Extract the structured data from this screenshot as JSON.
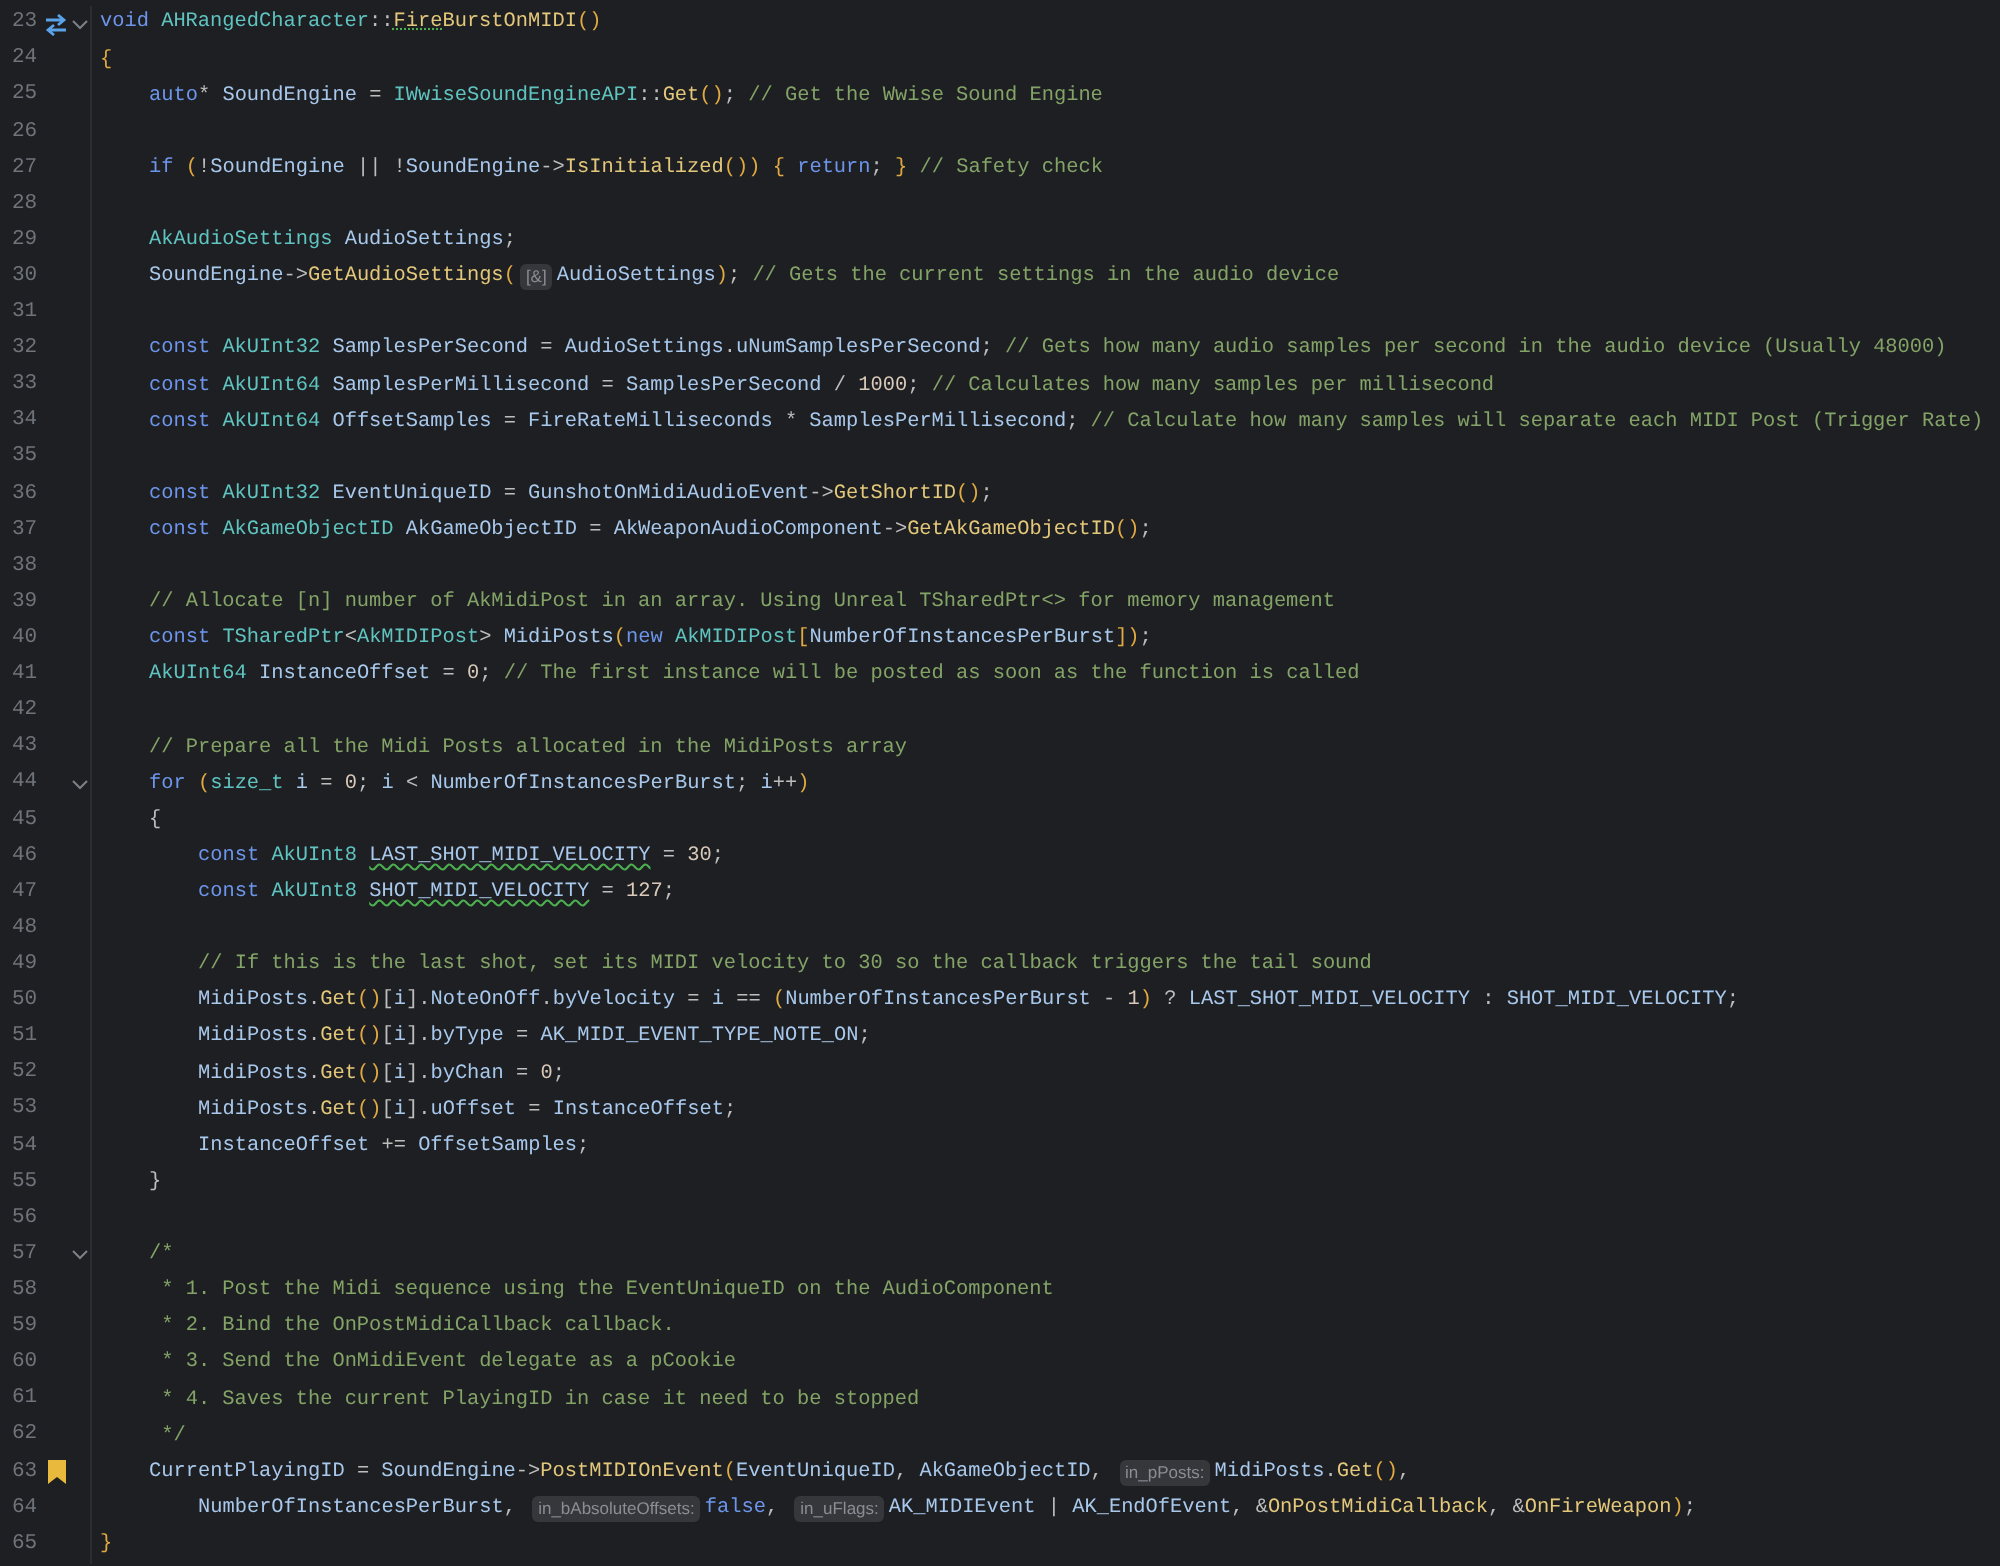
{
  "lines": [
    {
      "number": "23",
      "overrides": true,
      "fold": true,
      "segments": [
        {
          "kind": "kw",
          "text": "void "
        },
        {
          "kind": "type",
          "text": "AHRangedCharacter"
        },
        {
          "kind": "plain",
          "text": "::"
        },
        {
          "kind": "warnfunc",
          "text": "Fire"
        },
        {
          "kind": "func",
          "text": "BurstOnMIDI"
        },
        {
          "kind": "paren",
          "text": "()"
        }
      ]
    },
    {
      "number": "24",
      "fold": false,
      "segments": [
        {
          "kind": "paren",
          "text": "{"
        }
      ],
      "children": [
        {
          "number": "25",
          "fold": false,
          "segments": [
            {
              "kind": "kw",
              "text": "auto"
            },
            {
              "kind": "plain",
              "text": "* "
            },
            {
              "kind": "var",
              "text": "SoundEngine"
            },
            {
              "kind": "plain",
              "text": " = "
            },
            {
              "kind": "type",
              "text": "IWwiseSoundEngineAPI"
            },
            {
              "kind": "plain",
              "text": "::"
            },
            {
              "kind": "func",
              "text": "Get"
            },
            {
              "kind": "paren",
              "text": "()"
            },
            {
              "kind": "plain",
              "text": "; "
            },
            {
              "kind": "comment",
              "text": "// Get the Wwise Sound Engine"
            }
          ]
        },
        {
          "number": "26",
          "fold": false
        },
        {
          "number": "27",
          "fold": false,
          "segments": [
            {
              "kind": "kw",
              "text": "if "
            },
            {
              "kind": "paren",
              "text": "("
            },
            {
              "kind": "plain",
              "text": "!"
            },
            {
              "kind": "var",
              "text": "SoundEngine"
            },
            {
              "kind": "plain",
              "text": " || !"
            },
            {
              "kind": "var",
              "text": "SoundEngine"
            },
            {
              "kind": "plain",
              "text": "->"
            },
            {
              "kind": "func",
              "text": "IsInitialized"
            },
            {
              "kind": "paren",
              "text": "()) "
            },
            {
              "kind": "paren",
              "text": "{ "
            },
            {
              "kind": "kw",
              "text": "return"
            },
            {
              "kind": "plain",
              "text": "; "
            },
            {
              "kind": "paren",
              "text": "} "
            },
            {
              "kind": "comment",
              "text": "// Safety check"
            }
          ]
        },
        {
          "number": "28",
          "fold": false
        },
        {
          "number": "29",
          "fold": false,
          "segments": [
            {
              "kind": "type",
              "text": "AkAudioSettings "
            },
            {
              "kind": "var",
              "text": "AudioSettings"
            },
            {
              "kind": "plain",
              "text": ";"
            }
          ]
        },
        {
          "number": "30",
          "fold": false,
          "segments": [
            {
              "kind": "var",
              "text": "SoundEngine"
            },
            {
              "kind": "plain",
              "text": "->"
            },
            {
              "kind": "func",
              "text": "GetAudioSettings"
            },
            {
              "kind": "paren",
              "text": "("
            },
            {
              "kind": "hint",
              "text": "[&]"
            },
            {
              "kind": "var",
              "text": "AudioSettings"
            },
            {
              "kind": "paren",
              "text": ")"
            },
            {
              "kind": "plain",
              "text": "; "
            },
            {
              "kind": "comment",
              "text": "// Gets the current settings in the audio device"
            }
          ]
        },
        {
          "number": "31",
          "fold": false
        },
        {
          "number": "32",
          "fold": false,
          "segments": [
            {
              "kind": "kw",
              "text": "const "
            },
            {
              "kind": "type",
              "text": "AkUInt32 "
            },
            {
              "kind": "var",
              "text": "SamplesPerSecond"
            },
            {
              "kind": "plain",
              "text": " = "
            },
            {
              "kind": "var",
              "text": "AudioSettings"
            },
            {
              "kind": "plain",
              "text": "."
            },
            {
              "kind": "var",
              "text": "uNumSamplesPerSecond"
            },
            {
              "kind": "plain",
              "text": "; "
            },
            {
              "kind": "comment",
              "text": "// Gets how many audio samples per second in the audio device (Usually 48000)"
            }
          ]
        },
        {
          "number": "33",
          "fold": false,
          "segments": [
            {
              "kind": "kw",
              "text": "const "
            },
            {
              "kind": "type",
              "text": "AkUInt64 "
            },
            {
              "kind": "var",
              "text": "SamplesPerMillisecond"
            },
            {
              "kind": "plain",
              "text": " = "
            },
            {
              "kind": "var",
              "text": "SamplesPerSecond"
            },
            {
              "kind": "plain",
              "text": " / "
            },
            {
              "kind": "num",
              "text": "1000"
            },
            {
              "kind": "plain",
              "text": "; "
            },
            {
              "kind": "comment",
              "text": "// Calculates how many samples per millisecond"
            }
          ]
        },
        {
          "number": "34",
          "fold": false,
          "segments": [
            {
              "kind": "kw",
              "text": "const "
            },
            {
              "kind": "type",
              "text": "AkUInt64 "
            },
            {
              "kind": "var",
              "text": "OffsetSamples"
            },
            {
              "kind": "plain",
              "text": " = "
            },
            {
              "kind": "var",
              "text": "FireRateMilliseconds"
            },
            {
              "kind": "plain",
              "text": " * "
            },
            {
              "kind": "var",
              "text": "SamplesPerMillisecond"
            },
            {
              "kind": "plain",
              "text": "; "
            },
            {
              "kind": "comment",
              "text": "// Calculate how many samples will separate each MIDI Post (Trigger Rate)"
            }
          ]
        },
        {
          "number": "35",
          "fold": false
        },
        {
          "number": "36",
          "fold": false,
          "segments": [
            {
              "kind": "kw",
              "text": "const "
            },
            {
              "kind": "type",
              "text": "AkUInt32 "
            },
            {
              "kind": "var",
              "text": "EventUniqueID"
            },
            {
              "kind": "plain",
              "text": " = "
            },
            {
              "kind": "var",
              "text": "GunshotOnMidiAudioEvent"
            },
            {
              "kind": "plain",
              "text": "->"
            },
            {
              "kind": "func",
              "text": "GetShortID"
            },
            {
              "kind": "paren",
              "text": "()"
            },
            {
              "kind": "plain",
              "text": ";"
            }
          ]
        },
        {
          "number": "37",
          "fold": false,
          "segments": [
            {
              "kind": "kw",
              "text": "const "
            },
            {
              "kind": "type",
              "text": "AkGameObjectID "
            },
            {
              "kind": "var",
              "text": "AkGameObjectID"
            },
            {
              "kind": "plain",
              "text": " = "
            },
            {
              "kind": "var",
              "text": "AkWeaponAudioComponent"
            },
            {
              "kind": "plain",
              "text": "->"
            },
            {
              "kind": "func",
              "text": "GetAkGameObjectID"
            },
            {
              "kind": "paren",
              "text": "()"
            },
            {
              "kind": "plain",
              "text": ";"
            }
          ]
        },
        {
          "number": "38",
          "fold": false
        },
        {
          "number": "39",
          "fold": false,
          "segments": [
            {
              "kind": "comment",
              "text": "// Allocate [n] number of AkMidiPost in an array. Using Unreal TSharedPtr<> for memory management"
            }
          ]
        },
        {
          "number": "40",
          "fold": false,
          "segments": [
            {
              "kind": "kw",
              "text": "const "
            },
            {
              "kind": "type",
              "text": "TSharedPtr"
            },
            {
              "kind": "plain",
              "text": "<"
            },
            {
              "kind": "type",
              "text": "AkMIDIPost"
            },
            {
              "kind": "plain",
              "text": "> "
            },
            {
              "kind": "var",
              "text": "MidiPosts"
            },
            {
              "kind": "paren",
              "text": "("
            },
            {
              "kind": "kw",
              "text": "new "
            },
            {
              "kind": "type",
              "text": "AkMIDIPost"
            },
            {
              "kind": "paren",
              "text": "["
            },
            {
              "kind": "var",
              "text": "NumberOfInstancesPerBurst"
            },
            {
              "kind": "paren",
              "text": "])"
            },
            {
              "kind": "plain",
              "text": ";"
            }
          ]
        },
        {
          "number": "41",
          "fold": false,
          "segments": [
            {
              "kind": "type",
              "text": "AkUInt64 "
            },
            {
              "kind": "var",
              "text": "InstanceOffset"
            },
            {
              "kind": "plain",
              "text": " = "
            },
            {
              "kind": "num",
              "text": "0"
            },
            {
              "kind": "plain",
              "text": "; "
            },
            {
              "kind": "comment",
              "text": "// The first instance will be posted as soon as the function is called"
            }
          ]
        },
        {
          "number": "42",
          "fold": false
        },
        {
          "number": "43",
          "fold": false,
          "segments": [
            {
              "kind": "comment",
              "text": "// Prepare all the Midi Posts allocated in the MidiPosts array"
            }
          ]
        },
        {
          "number": "44",
          "fold": true,
          "segments": [
            {
              "kind": "kw",
              "text": "for "
            },
            {
              "kind": "paren",
              "text": "("
            },
            {
              "kind": "type",
              "text": "size_t "
            },
            {
              "kind": "var",
              "text": "i"
            },
            {
              "kind": "plain",
              "text": " = "
            },
            {
              "kind": "num",
              "text": "0"
            },
            {
              "kind": "plain",
              "text": "; "
            },
            {
              "kind": "var",
              "text": "i"
            },
            {
              "kind": "plain",
              "text": " < "
            },
            {
              "kind": "var",
              "text": "NumberOfInstancesPerBurst"
            },
            {
              "kind": "plain",
              "text": "; "
            },
            {
              "kind": "var",
              "text": "i"
            },
            {
              "kind": "plain",
              "text": "++"
            },
            {
              "kind": "paren",
              "text": ")"
            }
          ]
        },
        {
          "number": "45",
          "fold": false,
          "segments": [
            {
              "kind": "plain",
              "text": "{"
            }
          ],
          "children": [
            {
              "number": "46",
              "fold": false,
              "segments": [
                {
                  "kind": "kw",
                  "text": "const "
                },
                {
                  "kind": "type",
                  "text": "AkUInt8 "
                },
                {
                  "kind": "warnvar",
                  "text": "LAST_SHOT_MIDI_VELOCITY"
                },
                {
                  "kind": "plain",
                  "text": " = "
                },
                {
                  "kind": "num",
                  "text": "30"
                },
                {
                  "kind": "plain",
                  "text": ";"
                }
              ]
            },
            {
              "number": "47",
              "fold": false,
              "segments": [
                {
                  "kind": "kw",
                  "text": "const "
                },
                {
                  "kind": "type",
                  "text": "AkUInt8 "
                },
                {
                  "kind": "warnvar",
                  "text": "SHOT_MIDI_VELOCITY"
                },
                {
                  "kind": "plain",
                  "text": " = "
                },
                {
                  "kind": "num",
                  "text": "127"
                },
                {
                  "kind": "plain",
                  "text": ";"
                }
              ]
            },
            {
              "number": "48",
              "fold": false
            },
            {
              "number": "49",
              "fold": false,
              "segments": [
                {
                  "kind": "comment",
                  "text": "// If this is the last shot, set its MIDI velocity to 30 so the callback triggers the tail sound"
                }
              ]
            },
            {
              "number": "50",
              "fold": false,
              "segments": [
                {
                  "kind": "var",
                  "text": "MidiPosts"
                },
                {
                  "kind": "plain",
                  "text": "."
                },
                {
                  "kind": "func",
                  "text": "Get"
                },
                {
                  "kind": "paren",
                  "text": "()"
                },
                {
                  "kind": "plain",
                  "text": "["
                },
                {
                  "kind": "var",
                  "text": "i"
                },
                {
                  "kind": "plain",
                  "text": "]."
                },
                {
                  "kind": "var",
                  "text": "NoteOnOff"
                },
                {
                  "kind": "plain",
                  "text": "."
                },
                {
                  "kind": "var",
                  "text": "byVelocity"
                },
                {
                  "kind": "plain",
                  "text": " = "
                },
                {
                  "kind": "var",
                  "text": "i"
                },
                {
                  "kind": "plain",
                  "text": " == "
                },
                {
                  "kind": "paren",
                  "text": "("
                },
                {
                  "kind": "var",
                  "text": "NumberOfInstancesPerBurst"
                },
                {
                  "kind": "plain",
                  "text": " - "
                },
                {
                  "kind": "num",
                  "text": "1"
                },
                {
                  "kind": "paren",
                  "text": ")"
                },
                {
                  "kind": "plain",
                  "text": " ? "
                },
                {
                  "kind": "var",
                  "text": "LAST_SHOT_MIDI_VELOCITY"
                },
                {
                  "kind": "plain",
                  "text": " : "
                },
                {
                  "kind": "var",
                  "text": "SHOT_MIDI_VELOCITY"
                },
                {
                  "kind": "plain",
                  "text": ";"
                }
              ]
            },
            {
              "number": "51",
              "fold": false,
              "segments": [
                {
                  "kind": "var",
                  "text": "MidiPosts"
                },
                {
                  "kind": "plain",
                  "text": "."
                },
                {
                  "kind": "func",
                  "text": "Get"
                },
                {
                  "kind": "paren",
                  "text": "()"
                },
                {
                  "kind": "plain",
                  "text": "["
                },
                {
                  "kind": "var",
                  "text": "i"
                },
                {
                  "kind": "plain",
                  "text": "]."
                },
                {
                  "kind": "var",
                  "text": "byType"
                },
                {
                  "kind": "plain",
                  "text": " = "
                },
                {
                  "kind": "var",
                  "text": "AK_MIDI_EVENT_TYPE_NOTE_ON"
                },
                {
                  "kind": "plain",
                  "text": ";"
                }
              ]
            },
            {
              "number": "52",
              "fold": false,
              "segments": [
                {
                  "kind": "var",
                  "text": "MidiPosts"
                },
                {
                  "kind": "plain",
                  "text": "."
                },
                {
                  "kind": "func",
                  "text": "Get"
                },
                {
                  "kind": "paren",
                  "text": "()"
                },
                {
                  "kind": "plain",
                  "text": "["
                },
                {
                  "kind": "var",
                  "text": "i"
                },
                {
                  "kind": "plain",
                  "text": "]."
                },
                {
                  "kind": "var",
                  "text": "byChan"
                },
                {
                  "kind": "plain",
                  "text": " = "
                },
                {
                  "kind": "num",
                  "text": "0"
                },
                {
                  "kind": "plain",
                  "text": ";"
                }
              ]
            },
            {
              "number": "53",
              "fold": false,
              "segments": [
                {
                  "kind": "var",
                  "text": "MidiPosts"
                },
                {
                  "kind": "plain",
                  "text": "."
                },
                {
                  "kind": "func",
                  "text": "Get"
                },
                {
                  "kind": "paren",
                  "text": "()"
                },
                {
                  "kind": "plain",
                  "text": "["
                },
                {
                  "kind": "var",
                  "text": "i"
                },
                {
                  "kind": "plain",
                  "text": "]."
                },
                {
                  "kind": "var",
                  "text": "uOffset"
                },
                {
                  "kind": "plain",
                  "text": " = "
                },
                {
                  "kind": "var",
                  "text": "InstanceOffset"
                },
                {
                  "kind": "plain",
                  "text": ";"
                }
              ]
            },
            {
              "number": "54",
              "fold": false,
              "segments": [
                {
                  "kind": "var",
                  "text": "InstanceOffset"
                },
                {
                  "kind": "plain",
                  "text": " += "
                },
                {
                  "kind": "var",
                  "text": "OffsetSamples"
                },
                {
                  "kind": "plain",
                  "text": ";"
                }
              ]
            }
          ]
        },
        {
          "number": "55",
          "fold": false,
          "segments": [
            {
              "kind": "plain",
              "text": "}"
            }
          ]
        },
        {
          "number": "56",
          "fold": false
        },
        {
          "number": "57",
          "fold": true,
          "segments": [
            {
              "kind": "comment",
              "text": "/*"
            }
          ]
        },
        {
          "number": "58",
          "fold": false,
          "segments": [
            {
              "kind": "comment",
              "text": " * 1. Post the Midi sequence using the EventUniqueID on the AudioComponent"
            }
          ]
        },
        {
          "number": "59",
          "fold": false,
          "segments": [
            {
              "kind": "comment",
              "text": " * 2. Bind the OnPostMidiCallback callback."
            }
          ]
        },
        {
          "number": "60",
          "fold": false,
          "segments": [
            {
              "kind": "comment",
              "text": " * 3. Send the OnMidiEvent delegate as a pCookie"
            }
          ]
        },
        {
          "number": "61",
          "fold": false,
          "segments": [
            {
              "kind": "comment",
              "text": " * 4. Saves the current PlayingID in case it need to be stopped"
            }
          ]
        },
        {
          "number": "62",
          "fold": false,
          "segments": [
            {
              "kind": "comment",
              "text": " */"
            }
          ]
        },
        {
          "number": "63",
          "bookmarked": true,
          "fold": false,
          "segments": [
            {
              "kind": "var",
              "text": "CurrentPlayingID"
            },
            {
              "kind": "plain",
              "text": " = "
            },
            {
              "kind": "var",
              "text": "SoundEngine"
            },
            {
              "kind": "plain",
              "text": "->"
            },
            {
              "kind": "func",
              "text": "PostMIDIOnEvent"
            },
            {
              "kind": "paren",
              "text": "("
            },
            {
              "kind": "var",
              "text": "EventUniqueID"
            },
            {
              "kind": "plain",
              "text": ", "
            },
            {
              "kind": "var",
              "text": "AkGameObjectID"
            },
            {
              "kind": "plain",
              "text": ", "
            },
            {
              "kind": "hint",
              "text": "in_pPosts:"
            },
            {
              "kind": "var",
              "text": "MidiPosts"
            },
            {
              "kind": "plain",
              "text": "."
            },
            {
              "kind": "func",
              "text": "Get"
            },
            {
              "kind": "paren",
              "text": "()"
            },
            {
              "kind": "plain",
              "text": ","
            }
          ],
          "children": [
            {
              "number": "64",
              "fold": false,
              "segments": [
                {
                  "kind": "var",
                  "text": "NumberOfInstancesPerBurst"
                },
                {
                  "kind": "plain",
                  "text": ", "
                },
                {
                  "kind": "hint",
                  "text": "in_bAbsoluteOffsets:"
                },
                {
                  "kind": "kw",
                  "text": "false"
                },
                {
                  "kind": "plain",
                  "text": ", "
                },
                {
                  "kind": "hint",
                  "text": "in_uFlags:"
                },
                {
                  "kind": "var",
                  "text": "AK_MIDIEvent"
                },
                {
                  "kind": "plain",
                  "text": " | "
                },
                {
                  "kind": "var",
                  "text": "AK_EndOfEvent"
                },
                {
                  "kind": "plain",
                  "text": ", &"
                },
                {
                  "kind": "func",
                  "text": "OnPostMidiCallback"
                },
                {
                  "kind": "plain",
                  "text": ", &"
                },
                {
                  "kind": "func",
                  "text": "OnFireWeapon"
                },
                {
                  "kind": "paren",
                  "text": ")"
                },
                {
                  "kind": "plain",
                  "text": ";"
                }
              ]
            }
          ]
        }
      ]
    },
    {
      "number": "65",
      "fold": false,
      "segments": [
        {
          "kind": "paren",
          "text": "}"
        }
      ]
    }
  ]
}
